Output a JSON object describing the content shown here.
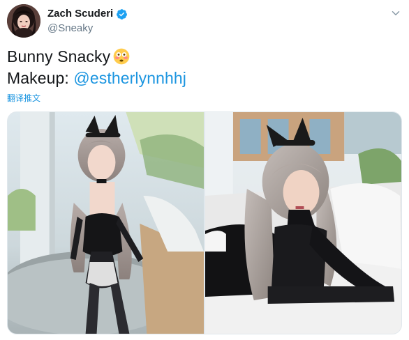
{
  "author": {
    "display_name": "Zach Scuderi",
    "username": "@Sneaky",
    "verified": true
  },
  "tweet": {
    "line1": "Bunny Snacky",
    "line1_emoji": "flushed-face-emoji",
    "line2_prefix": "Makeup: ",
    "mention": "@estherlynnhhj",
    "translate_label": "翻译推文"
  },
  "media": {
    "photos": [
      {
        "name": "photo-1",
        "description_icon": "cosplay-photo"
      },
      {
        "name": "photo-2",
        "description_icon": "cosplay-photo"
      }
    ]
  },
  "colors": {
    "text": "#14171a",
    "secondary": "#657786",
    "link": "#1b95e0",
    "verified": "#1da1f2"
  }
}
